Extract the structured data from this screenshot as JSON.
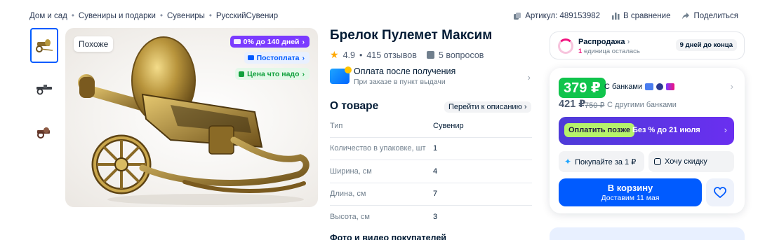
{
  "breadcrumbs": [
    "Дом и сад",
    "Сувениры и подарки",
    "Сувениры",
    "РусскийСувенир"
  ],
  "meta": {
    "article": "Артикул: 489153982",
    "compare": "В сравнение",
    "share": "Поделиться"
  },
  "gallery": {
    "thumbnails": [
      "thumb-1",
      "thumb-2",
      "thumb-3"
    ],
    "similar_label": "Похоже",
    "badges": {
      "installment": "0% до 140 дней",
      "postpay": "Постоплата",
      "good_price": "Цена что надо"
    }
  },
  "product": {
    "title": "Брелок Пулемет Максим",
    "rating": "4.9",
    "reviews": "415 отзывов",
    "questions": "5 вопросов",
    "payment_title": "Оплата после получения",
    "payment_sub": "При заказе в пункт выдачи"
  },
  "about": {
    "heading": "О товаре",
    "to_description": "Перейти к описанию",
    "specs": [
      {
        "key": "Тип",
        "value": "Сувенир"
      },
      {
        "key": "Количество в упаковке, шт",
        "value": "1"
      },
      {
        "key": "Ширина, см",
        "value": "4"
      },
      {
        "key": "Длина, см",
        "value": "7"
      },
      {
        "key": "Высота, см",
        "value": "3"
      }
    ],
    "photos_heading": "Фото и видео покупателей"
  },
  "sale": {
    "title": "Распродажа",
    "units_left_count": "1",
    "units_left_text": "единица осталась",
    "days_left": "9 дней до конца"
  },
  "buy": {
    "price": "379 ₽",
    "with_banks": "С банками",
    "alt_price": "421 ₽",
    "old_price": "750 ₽",
    "other_banks": "С другими банками",
    "pay_later_button": "Оплатить позже",
    "pay_later_text": "Без % до 21 июля",
    "buy_for_1": "Покупайте за 1 ₽",
    "want_discount": "Хочу скидку",
    "cart_title": "В корзину",
    "cart_delivery": "Доставим 11 мая"
  },
  "colors": {
    "accent": "#005bff",
    "price_green": "#10c44c",
    "installment_purple": "#7b3bff",
    "sale_pink": "#f1117e"
  },
  "icons": [
    "chevron-right-icon",
    "copy-icon",
    "compare-icon",
    "share-icon",
    "star-icon",
    "question-icon",
    "payment-card-icon",
    "heart-icon"
  ]
}
